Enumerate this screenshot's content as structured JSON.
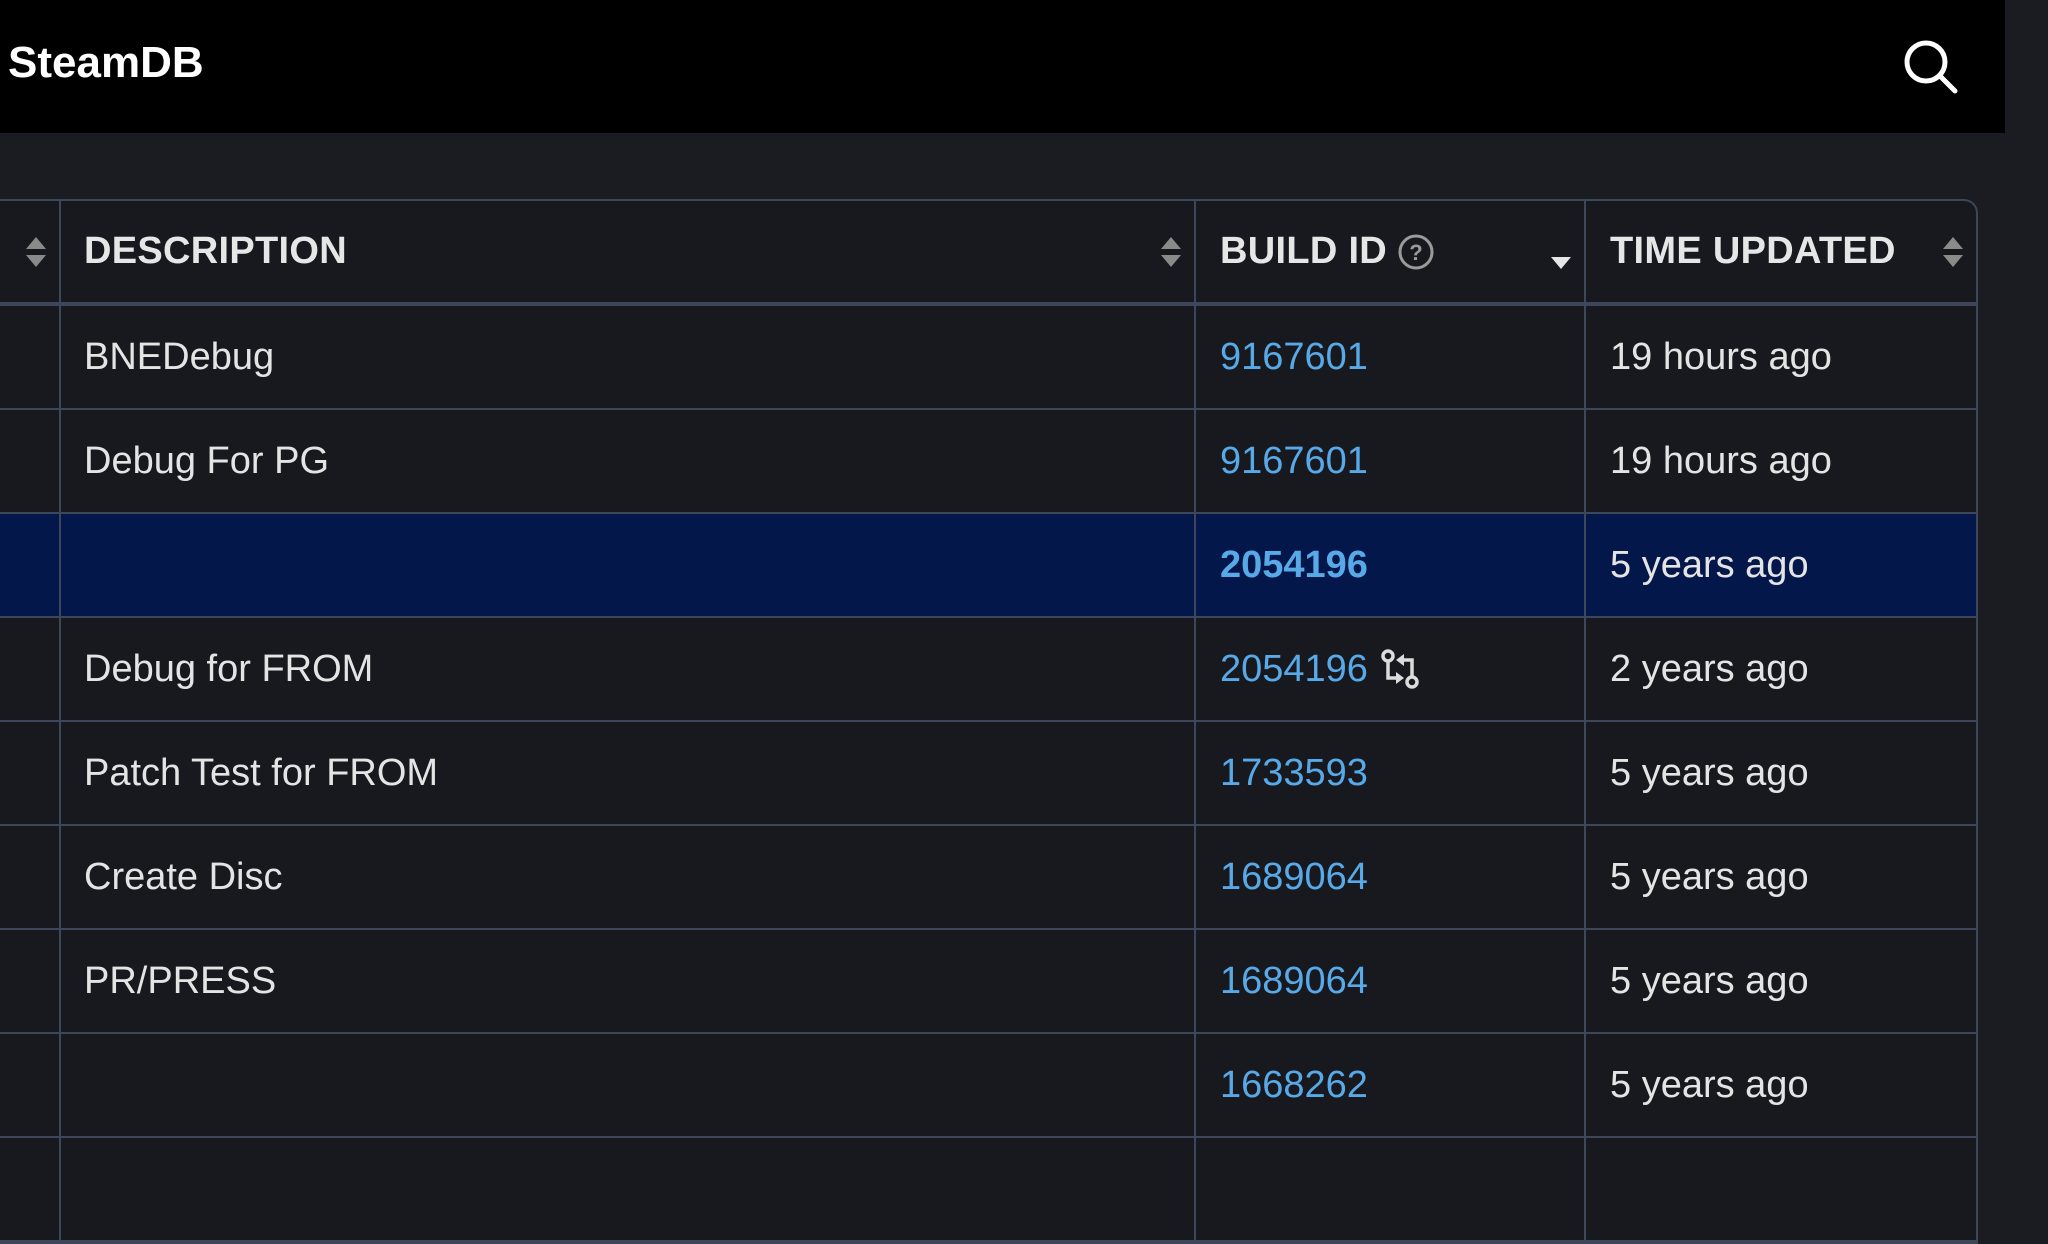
{
  "header": {
    "brand": "SteamDB",
    "search_icon": "search-icon"
  },
  "table": {
    "columns": [
      {
        "label": "",
        "sort": "both"
      },
      {
        "label": "DESCRIPTION",
        "sort": "both"
      },
      {
        "label": "BUILD ID",
        "sort": "desc",
        "help_icon": "question-circle-icon"
      },
      {
        "label": "TIME UPDATED",
        "sort": "both"
      }
    ],
    "rows": [
      {
        "description": "BNEDebug",
        "build_id": "9167601",
        "time": "19 hours ago",
        "selected": false,
        "branch_icon": false
      },
      {
        "description": "Debug For PG",
        "build_id": "9167601",
        "time": "19 hours ago",
        "selected": false,
        "branch_icon": false
      },
      {
        "description": "",
        "build_id": "2054196",
        "time": "5 years ago",
        "selected": true,
        "branch_icon": false
      },
      {
        "description": "Debug for FROM",
        "build_id": "2054196",
        "time": "2 years ago",
        "selected": false,
        "branch_icon": true
      },
      {
        "description": "Patch Test for FROM",
        "build_id": "1733593",
        "time": "5 years ago",
        "selected": false,
        "branch_icon": false
      },
      {
        "description": "Create Disc",
        "build_id": "1689064",
        "time": "5 years ago",
        "selected": false,
        "branch_icon": false
      },
      {
        "description": "PR/PRESS",
        "build_id": "1689064",
        "time": "5 years ago",
        "selected": false,
        "branch_icon": false
      },
      {
        "description": "",
        "build_id": "1668262",
        "time": "5 years ago",
        "selected": false,
        "branch_icon": false
      },
      {
        "description": "",
        "build_id": "",
        "time": "",
        "selected": false,
        "branch_icon": false
      }
    ]
  },
  "colors": {
    "link": "#57a9e8",
    "selected_row": "#04174a",
    "border": "#3c475a"
  }
}
